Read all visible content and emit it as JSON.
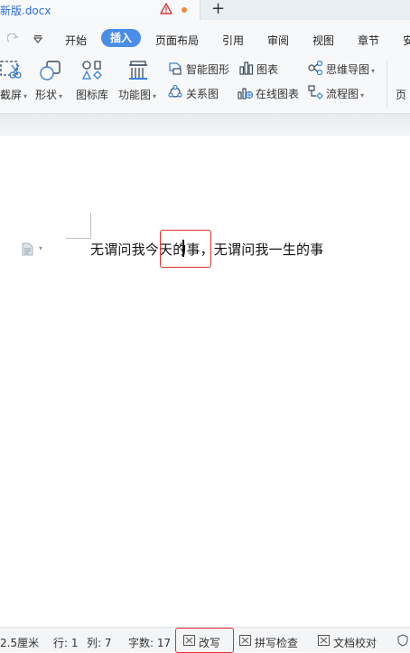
{
  "tabbar": {
    "doc_title": "新版.docx",
    "new_tab": "+"
  },
  "menu": {
    "items": [
      "开始",
      "插入",
      "页面布局",
      "引用",
      "审阅",
      "视图",
      "章节",
      "安"
    ]
  },
  "toolbar": {
    "screenshot": "截屏",
    "shapes": "形状",
    "icon_library": "图标库",
    "function_chart": "功能图",
    "smart_shape": "智能图形",
    "chart": "图表",
    "mind_map": "思维导图",
    "relation_chart": "关系图",
    "online_chart": "在线图表",
    "flowchart": "流程图",
    "page": "页"
  },
  "document": {
    "text": "无谓问我今天的事，无谓问我一生的事"
  },
  "statusbar": {
    "page_margin": "2.5厘米",
    "row": "行: 1",
    "col": "列: 7",
    "word_count": "字数: 17",
    "revise": "改写",
    "spell_check": "拼写检查",
    "doc_proof": "文档校对"
  },
  "colors": {
    "accent": "#4a8de6",
    "highlight": "#e0312c",
    "title": "#2b6cd8"
  }
}
